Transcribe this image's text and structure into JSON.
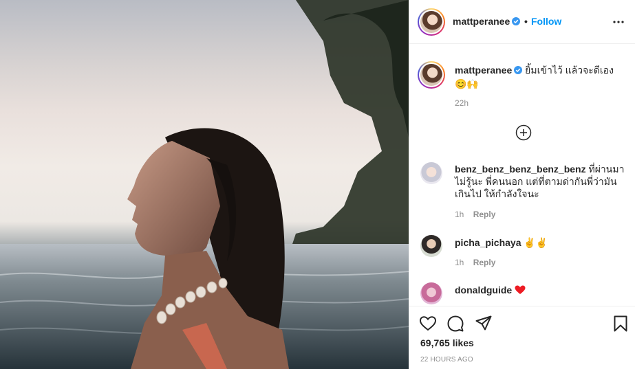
{
  "photo": {
    "alt_subject": "woman-in-pool-at-sunset"
  },
  "header": {
    "username": "mattperanee",
    "separator": "•",
    "follow_label": "Follow"
  },
  "caption": {
    "username": "mattperanee",
    "text": "ยิ้มเข้าไว้ แล้วจะดีเอง",
    "emoji": "😊🙌",
    "time": "22h"
  },
  "comments": [
    {
      "username": "benz_benz_benz_benz_benz",
      "text": "ที่ผ่านมาไม่รู้นะ พี่คนนอก แต่ที่ตามด่ากันพี่ว่ามันเกินไป ให้กำลังใจนะ",
      "time": "1h",
      "reply_label": "Reply"
    },
    {
      "username": "picha_pichaya",
      "text": "✌️✌️",
      "time": "1h",
      "reply_label": "Reply"
    },
    {
      "username": "donaldguide",
      "text": ""
    }
  ],
  "stats": {
    "likes": "69,765 likes",
    "posted": "22 HOURS AGO"
  },
  "colors": {
    "accent": "#0095f6",
    "text": "#262626",
    "muted": "#8e8e8e",
    "heart": "#ed4956"
  }
}
